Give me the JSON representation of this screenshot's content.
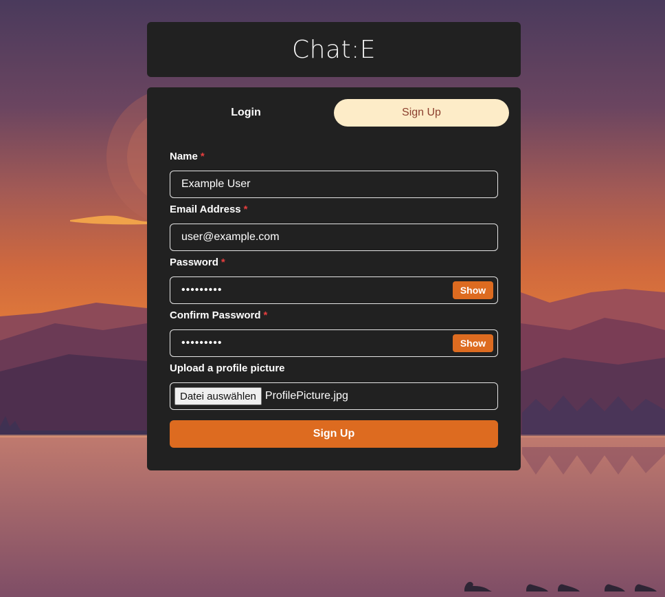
{
  "app": {
    "title": "Chat:E"
  },
  "tabs": [
    {
      "label": "Login",
      "active": false
    },
    {
      "label": "Sign Up",
      "active": true
    }
  ],
  "form": {
    "name": {
      "label": "Name",
      "required_mark": "*",
      "value": "Example User"
    },
    "email": {
      "label": "Email Address",
      "required_mark": "*",
      "value": "user@example.com"
    },
    "password": {
      "label": "Password",
      "required_mark": "*",
      "value": "•••••••••",
      "toggle_label": "Show"
    },
    "confirm_password": {
      "label": "Confirm Password",
      "required_mark": "*",
      "value": "•••••••••",
      "toggle_label": "Show"
    },
    "picture": {
      "label": "Upload a profile picture",
      "button_label": "Datei auswählen",
      "file_name": "ProfilePicture.jpg"
    },
    "submit_label": "Sign Up"
  },
  "colors": {
    "card": "#212121",
    "accent": "#dd6b20",
    "active_tab_bg": "#fdecc8",
    "active_tab_text": "#8b3f2e",
    "required": "#e53e3e"
  }
}
